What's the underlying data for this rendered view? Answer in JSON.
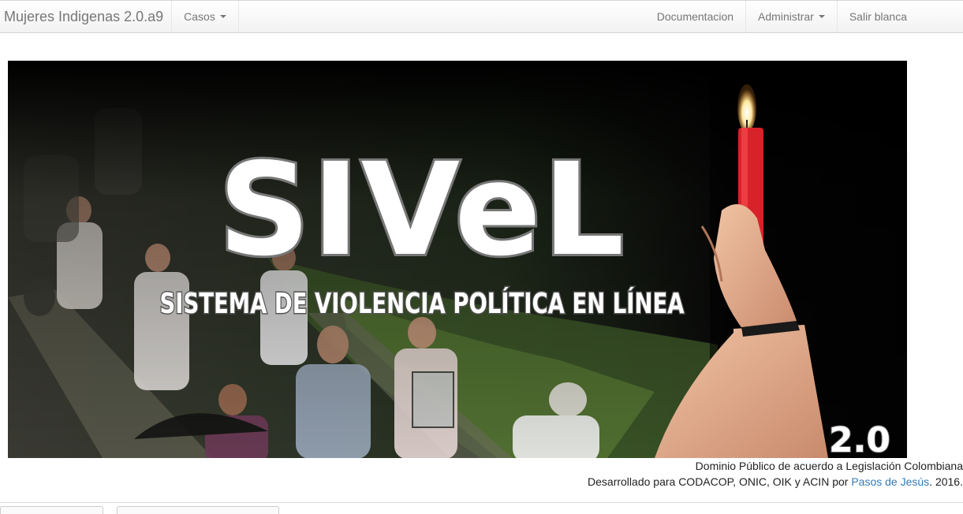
{
  "navbar": {
    "brand": "Mujeres Indigenas 2.0.a9",
    "left_items": [
      {
        "label": "Casos",
        "has_dropdown": true
      }
    ],
    "right_items": [
      {
        "label": "Documentacion",
        "has_dropdown": false
      },
      {
        "label": "Administrar",
        "has_dropdown": true
      },
      {
        "label": "Salir blanca",
        "has_dropdown": false
      }
    ]
  },
  "banner": {
    "title": "SIVeL",
    "subtitle": "SISTEMA DE VIOLENCIA POLÍTICA EN LÍNEA",
    "version": "2.0"
  },
  "footer": {
    "license": "Dominio Público de acuerdo a Legislación Colombiana",
    "developed_prefix": "Desarrollado para CODACOP, ONIC, OIK y ACIN por ",
    "developer_link": "Pasos de Jesús",
    "developed_suffix": ". 2016."
  }
}
